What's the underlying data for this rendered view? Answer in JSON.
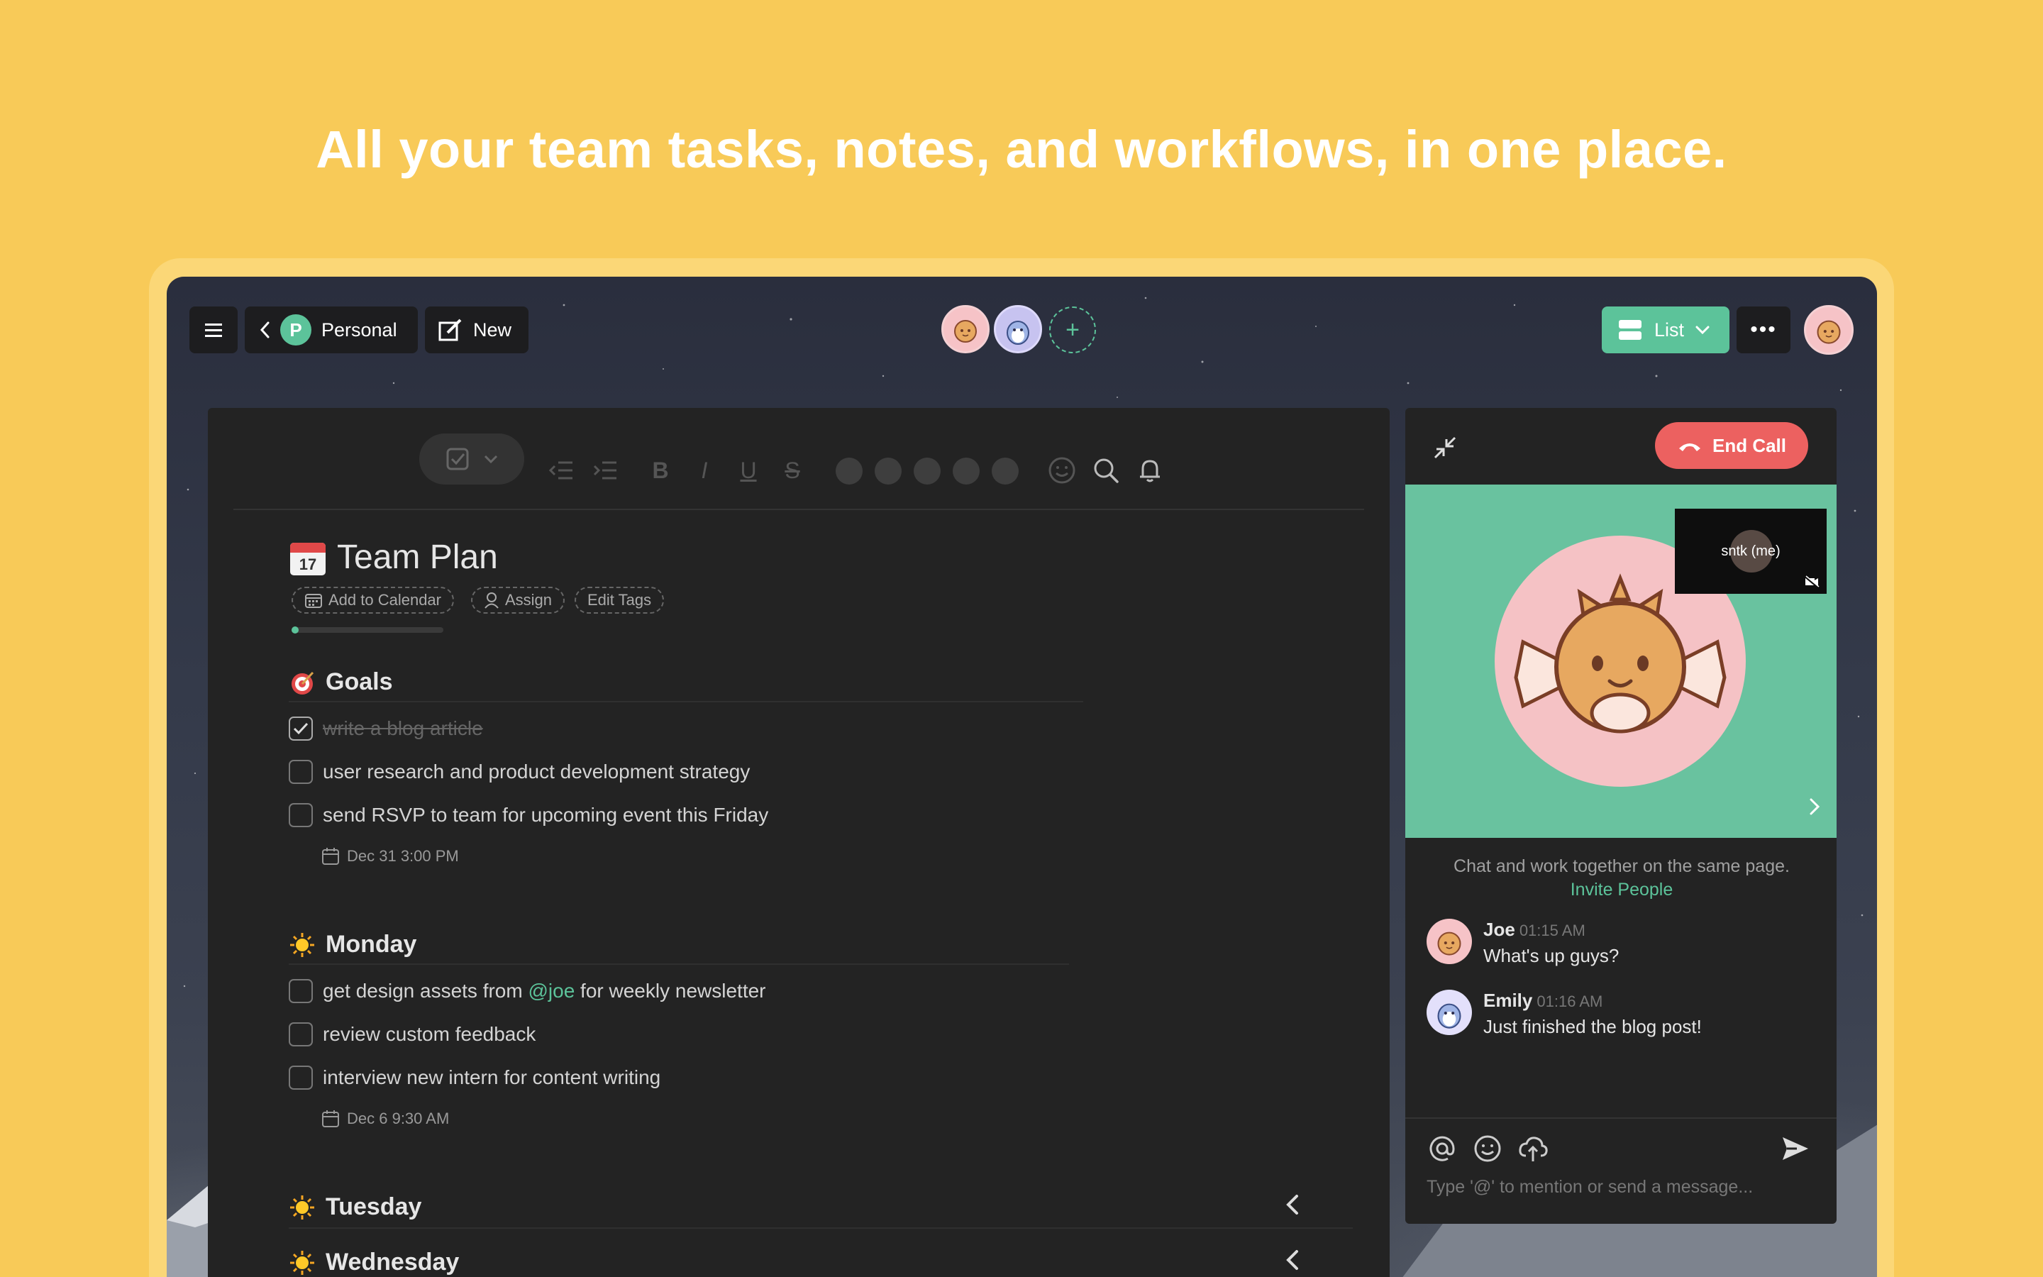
{
  "headline": "All your team tasks, notes, and workflows, in one place.",
  "topbar": {
    "workspace_badge": "P",
    "workspace_label": "Personal",
    "new_label": "New",
    "add_member_label": "+",
    "view_label": "List",
    "more_label": "•••"
  },
  "editor": {
    "toolbar": {
      "bold": "B",
      "italic": "I",
      "underline": "U",
      "strike": "S"
    },
    "title_icon": "calendar-emoji",
    "title": "Team Plan",
    "actions": {
      "add_to_calendar": "Add to Calendar",
      "assign": "Assign",
      "edit_tags": "Edit Tags"
    },
    "progress": 0.03,
    "sections": {
      "goals": {
        "title": "Goals",
        "tasks": [
          {
            "text": "write a blog article",
            "done": true
          },
          {
            "text": "user research and product development strategy",
            "done": false
          },
          {
            "text": "send RSVP to team for upcoming event this Friday",
            "done": false,
            "due": "Dec 31 3:00 PM"
          }
        ]
      },
      "monday": {
        "title": "Monday",
        "tasks": [
          {
            "text_before": "get design assets from ",
            "mention": "@joe",
            "text_after": " for weekly newsletter",
            "done": false
          },
          {
            "text": "review custom feedback",
            "done": false
          },
          {
            "text": "interview new intern for content writing",
            "done": false,
            "due": "Dec 6 9:30 AM"
          }
        ]
      },
      "tuesday": {
        "title": "Tuesday"
      },
      "wednesday": {
        "title": "Wednesday"
      }
    }
  },
  "chat": {
    "end_call_label": "End Call",
    "self_view_label": "sntk (me)",
    "intro_text": "Chat and work together on the same page.",
    "invite_label": "Invite People",
    "messages": [
      {
        "name": "Joe",
        "time": "01:15 AM",
        "text": "What's up guys?"
      },
      {
        "name": "Emily",
        "time": "01:16 AM",
        "text": "Just finished the blog post!"
      }
    ],
    "input_placeholder": "Type '@' to mention or send a message..."
  },
  "colors": {
    "background": "#f8ca58",
    "accent": "#5cc39a",
    "end_call": "#ec6160",
    "editor_bg": "#232323"
  }
}
